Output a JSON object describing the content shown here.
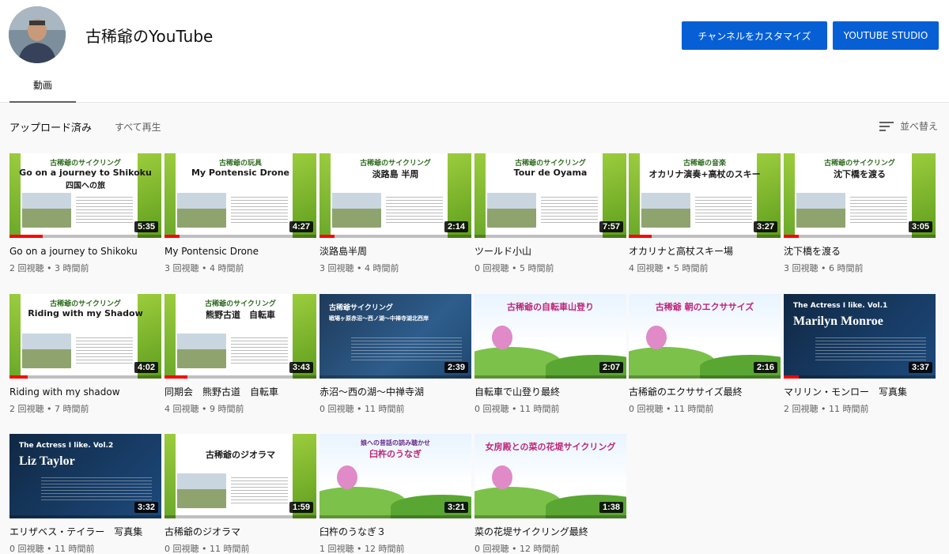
{
  "channel": {
    "name": "古稀爺のYouTube",
    "customize_label": "チャンネルをカスタマイズ",
    "studio_label": "YOUTUBE STUDIO",
    "tab_videos": "動画"
  },
  "section": {
    "title": "アップロード済み",
    "play_all": "すべて再生",
    "sort_label": "並べ替え"
  },
  "colors": {
    "accent": "#065fd4",
    "progress": "#ff0000"
  },
  "videos": [
    {
      "title": "Go on a journey to Shikoku",
      "views": "2 回視聴",
      "age": "3 時間前",
      "duration": "5:35",
      "thumb_heading": "古稀爺のサイクリング",
      "thumb_title": "Go on a journey to Shikoku",
      "thumb_sub": "四国への旅",
      "progress": 0.22
    },
    {
      "title": "My Pontensic Drone",
      "views": "3 回視聴",
      "age": "4 時間前",
      "duration": "4:27",
      "thumb_heading": "古稀爺の玩具",
      "thumb_title": "My Pontensic Drone",
      "thumb_sub": "",
      "progress": 0.1
    },
    {
      "title": "淡路島半周",
      "views": "3 回視聴",
      "age": "4 時間前",
      "duration": "2:14",
      "thumb_heading": "古稀爺のサイクリング",
      "thumb_title": "淡路島 半周",
      "thumb_sub": "",
      "progress": 0.1
    },
    {
      "title": "ツールド小山",
      "views": "0 回視聴",
      "age": "5 時間前",
      "duration": "7:57",
      "thumb_heading": "古稀爺のサイクリング",
      "thumb_title": "Tour de Oyama",
      "thumb_sub": "",
      "progress": 0.0
    },
    {
      "title": "オカリナと高杖スキー場",
      "views": "4 回視聴",
      "age": "5 時間前",
      "duration": "3:27",
      "thumb_heading": "古稀爺の音楽",
      "thumb_title": "オカリナ演奏+高杖のスキー",
      "thumb_sub": "",
      "progress": 0.15
    },
    {
      "title": "沈下橋を渡る",
      "views": "3 回視聴",
      "age": "6 時間前",
      "duration": "3:05",
      "thumb_heading": "古稀爺のサイクリング",
      "thumb_title": "沈下橋を渡る",
      "thumb_sub": "",
      "progress": 0.1
    },
    {
      "title": "Riding with my shadow",
      "views": "2 回視聴",
      "age": "7 時間前",
      "duration": "4:02",
      "thumb_heading": "古稀爺のサイクリング",
      "thumb_title": "Riding with my Shadow",
      "thumb_sub": "",
      "progress": 0.12
    },
    {
      "title": "同期会　熊野古道　自転車",
      "views": "4 回視聴",
      "age": "9 時間前",
      "duration": "3:43",
      "thumb_heading": "古稀爺のサイクリング",
      "thumb_title": "熊野古道　自転車",
      "thumb_sub": "",
      "progress": 0.15
    },
    {
      "title": "赤沼〜西の湖〜中禅寺湖",
      "views": "0 回視聴",
      "age": "11 時間前",
      "duration": "2:39",
      "thumb_heading": "古稀爺サイクリング",
      "thumb_title": "戦場ヶ原赤沼〜西ノ湖〜中禅寺湖北西岸",
      "thumb_sub": "",
      "progress": 0.0
    },
    {
      "title": "自転車で山登り最終",
      "views": "0 回視聴",
      "age": "11 時間前",
      "duration": "2:07",
      "thumb_heading": "",
      "thumb_title": "古稀爺の自転車山登り",
      "thumb_sub": "",
      "progress": 0.0
    },
    {
      "title": "古稀爺のエクササイズ最終",
      "views": "0 回視聴",
      "age": "11 時間前",
      "duration": "2:16",
      "thumb_heading": "",
      "thumb_title": "古稀爺 朝のエクササイズ",
      "thumb_sub": "",
      "progress": 0.0
    },
    {
      "title": "マリリン・モンロー　写真集",
      "views": "2 回視聴",
      "age": "11 時間前",
      "duration": "3:37",
      "thumb_heading": "The Actress I like. Vol.1",
      "thumb_title": "Marilyn Monroe",
      "thumb_sub": "",
      "progress": 0.1
    },
    {
      "title": "エリザベス・テイラー　写真集",
      "views": "0 回視聴",
      "age": "11 時間前",
      "duration": "3:32",
      "thumb_heading": "The Actress I like. Vol.2",
      "thumb_title": "Liz Taylor",
      "thumb_sub": "",
      "progress": 0.0
    },
    {
      "title": "古稀爺のジオラマ",
      "views": "0 回視聴",
      "age": "11 時間前",
      "duration": "1:59",
      "thumb_heading": "",
      "thumb_title": "古稀爺のジオラマ",
      "thumb_sub": "",
      "progress": 0.0
    },
    {
      "title": "臼杵のうなぎ３",
      "views": "1 回視聴",
      "age": "12 時間前",
      "duration": "3:21",
      "thumb_heading": "娘への昔話の読み聴かせ",
      "thumb_title": "臼杵のうなぎ",
      "thumb_sub": "",
      "progress": 0.0
    },
    {
      "title": "菜の花堤サイクリング最終",
      "views": "0 回視聴",
      "age": "12 時間前",
      "duration": "1:38",
      "thumb_heading": "",
      "thumb_title": "女房殿との菜の花堤サイクリング",
      "thumb_sub": "",
      "progress": 0.0
    }
  ]
}
